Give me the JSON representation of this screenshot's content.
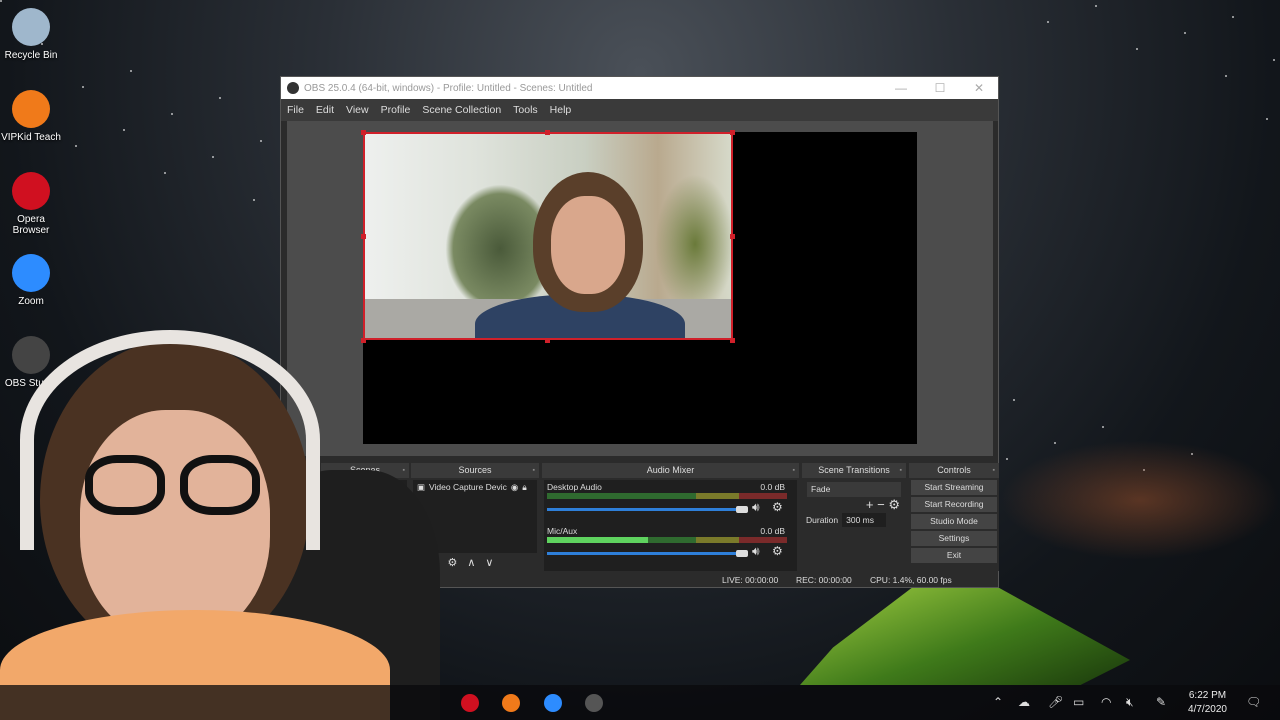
{
  "desktop": {
    "icons": [
      {
        "label": "Recycle Bin",
        "icon": "recycle-bin-icon",
        "color": "#9fb7cc"
      },
      {
        "label": "VIPKid Teach",
        "icon": "vipkid-icon",
        "color": "#f07a1a"
      },
      {
        "label": "Opera Browser",
        "icon": "opera-icon",
        "color": "#d01020"
      },
      {
        "label": "Zoom",
        "icon": "zoom-icon",
        "color": "#2d8cff"
      },
      {
        "label": "OBS Studio",
        "icon": "obs-icon",
        "color": "#444444"
      }
    ]
  },
  "window": {
    "title": "OBS 25.0.4 (64-bit, windows) - Profile: Untitled - Scenes: Untitled",
    "controls": {
      "minimize": "—",
      "maximize": "☐",
      "close": "✕"
    },
    "menu": [
      "File",
      "Edit",
      "View",
      "Profile",
      "Scene Collection",
      "Tools",
      "Help"
    ],
    "accent": "#d0202a"
  },
  "docks": {
    "scenes": {
      "title": "Scenes"
    },
    "sources": {
      "title": "Sources",
      "items": [
        {
          "label": "Video Capture Devic",
          "visible": true,
          "locked": true
        }
      ],
      "toolbar": [
        "−",
        "⚙",
        "∧",
        "∨"
      ]
    },
    "audio_mixer": {
      "title": "Audio Mixer",
      "channels": [
        {
          "name": "Desktop Audio",
          "level": "0.0 dB",
          "volume": 1.0
        },
        {
          "name": "Mic/Aux",
          "level": "0.0 dB",
          "volume": 1.0
        }
      ]
    },
    "scene_transitions": {
      "title": "Scene Transitions",
      "transition": "Fade",
      "duration_label": "Duration",
      "duration": "300 ms"
    },
    "controls": {
      "title": "Controls",
      "buttons": [
        "Start Streaming",
        "Start Recording",
        "Studio Mode",
        "Settings",
        "Exit"
      ]
    }
  },
  "status": {
    "live": "LIVE: 00:00:00",
    "rec": "REC: 00:00:00",
    "cpu": "CPU: 1.4%, 60.00 fps"
  },
  "taskbar": {
    "apps": [
      {
        "name": "opera",
        "color": "#d01020"
      },
      {
        "name": "vipkid",
        "color": "#f07a1a"
      },
      {
        "name": "zoom",
        "color": "#2d8cff"
      },
      {
        "name": "obs",
        "color": "#555555"
      }
    ],
    "time": "6:22 PM",
    "date": "4/7/2020"
  }
}
